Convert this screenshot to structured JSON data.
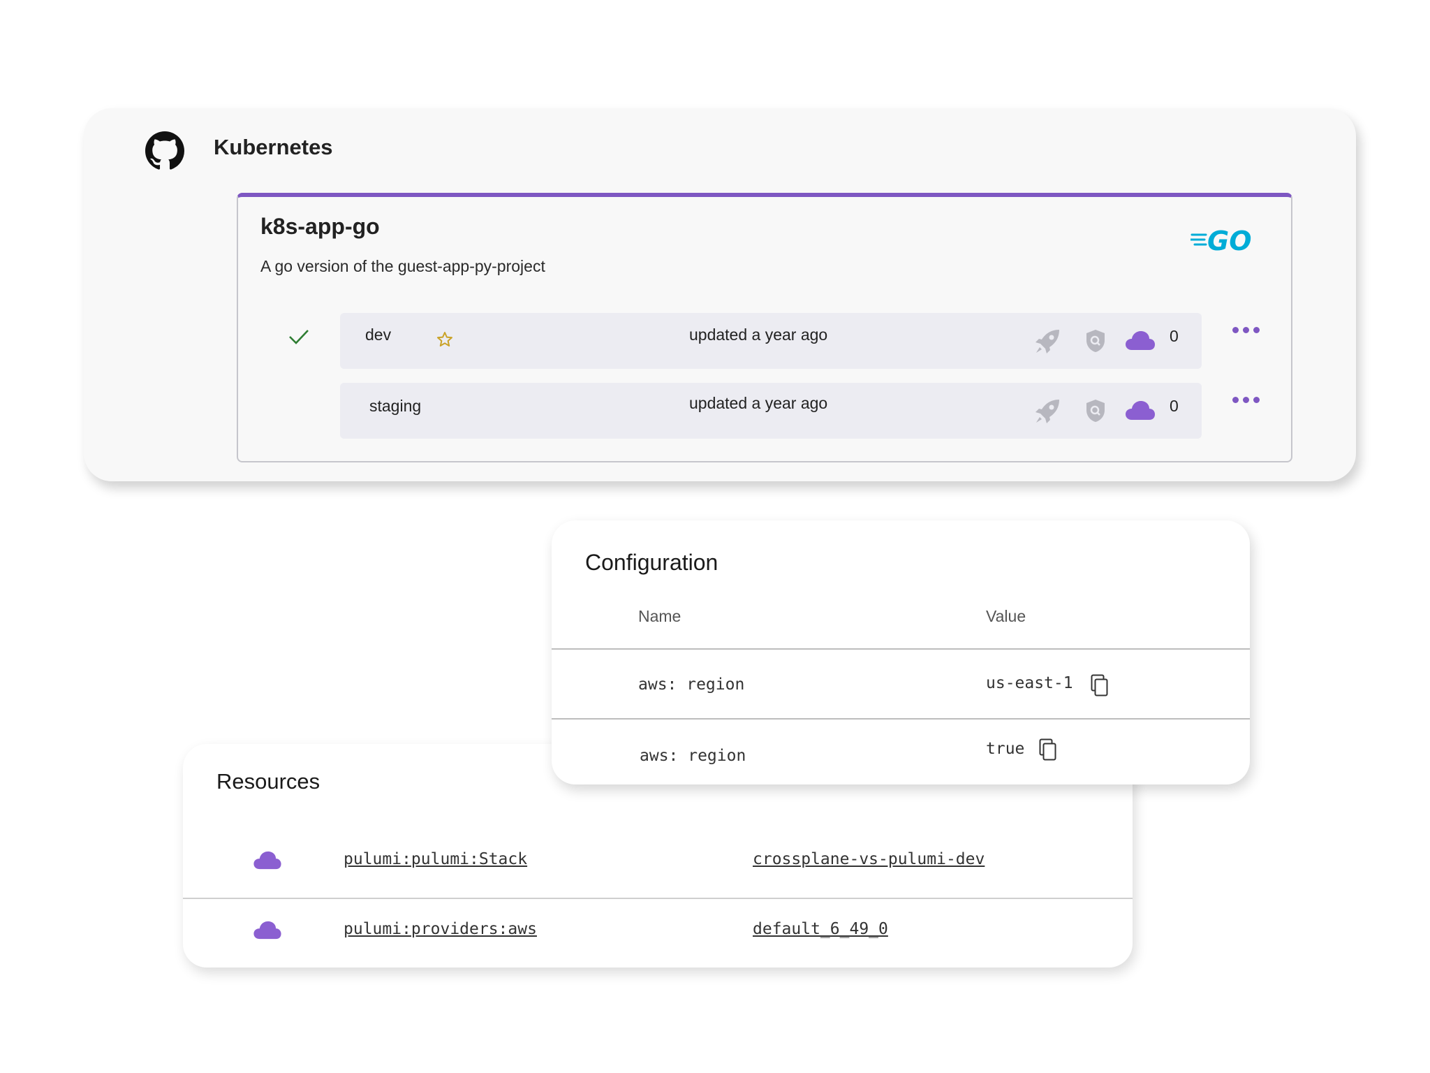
{
  "project_card": {
    "org_name": "Kubernetes",
    "project": {
      "title": "k8s-app-go",
      "description": "A go version of the guest-app-py-project",
      "language_logo": "go-logo"
    },
    "stacks": [
      {
        "name": "dev",
        "updated": "updated a year ago",
        "resource_count": "0",
        "favorite": true,
        "selected": true
      },
      {
        "name": "staging",
        "updated": "updated a year ago",
        "resource_count": "0",
        "favorite": false,
        "selected": false
      }
    ],
    "accent_color": "#7e57c2"
  },
  "configuration": {
    "title": "Configuration",
    "columns": [
      "Name",
      "Value"
    ],
    "rows": [
      {
        "name": "aws: region",
        "value": "us-east-1"
      },
      {
        "name": "aws: region",
        "value": "true"
      }
    ]
  },
  "resources": {
    "title": "Resources",
    "rows": [
      {
        "type": "pulumi:pulumi:Stack",
        "name": "crossplane-vs-pulumi-dev"
      },
      {
        "type": "pulumi:providers:aws",
        "name": "default_6_49_0"
      }
    ]
  },
  "colors": {
    "purple": "#7e57c2",
    "go_blue": "#00acd7",
    "check_green": "#2e7d32",
    "star_gold": "#c9a227"
  }
}
